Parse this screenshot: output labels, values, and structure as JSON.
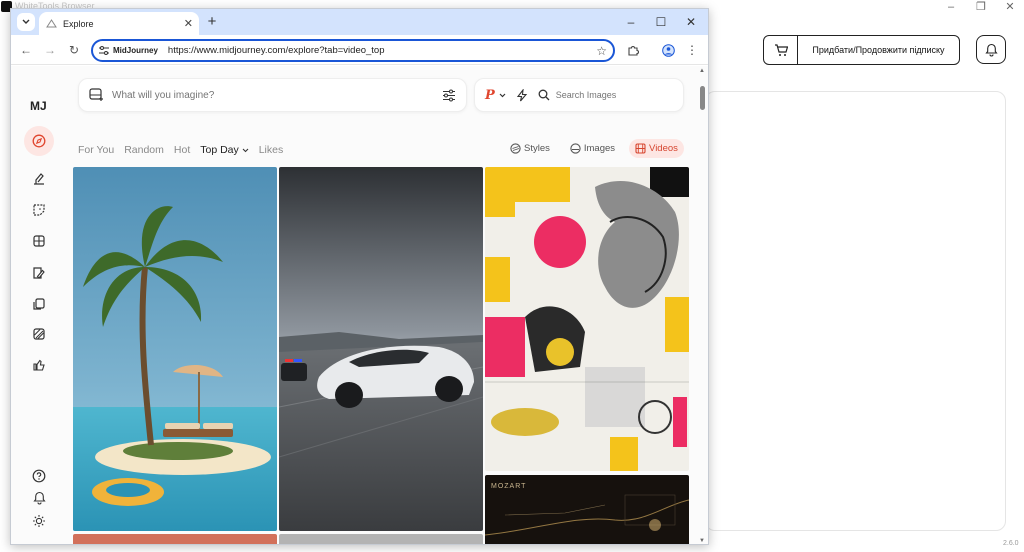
{
  "host": {
    "title": "WhiteTools Browser",
    "cart_label": "Придбати/Продовжити підписку",
    "version": "2.6.0"
  },
  "browser": {
    "tab_title": "Explore",
    "site_chip": "MidJourney",
    "url": "https://www.midjourney.com/explore?tab=video_top"
  },
  "sidebar": {
    "logo": "MJ",
    "items": [
      {
        "icon": "compass-icon",
        "active": true
      },
      {
        "icon": "brush-icon"
      },
      {
        "icon": "sticker-icon"
      },
      {
        "icon": "grid-icon"
      },
      {
        "icon": "edit-image-icon"
      },
      {
        "icon": "copy-icon"
      },
      {
        "icon": "pattern-icon"
      },
      {
        "icon": "thumbs-up-icon"
      }
    ],
    "bottom": [
      {
        "icon": "help-icon"
      },
      {
        "icon": "bell-icon"
      },
      {
        "icon": "sun-icon"
      }
    ]
  },
  "prompt": {
    "placeholder": "What will you imagine?"
  },
  "search": {
    "placeholder": "Search Images",
    "p_label": "P"
  },
  "filters": {
    "tabs": [
      "For You",
      "Random",
      "Hot",
      "Top Day",
      "Likes"
    ],
    "active": "Top Day",
    "types": [
      "Styles",
      "Images",
      "Videos"
    ],
    "active_type": "Videos"
  },
  "gallery": {
    "cards": [
      {
        "name": "palm-island-card",
        "subject": "palm-island"
      },
      {
        "name": "sports-car-card",
        "subject": "sports-car"
      },
      {
        "name": "collage-card",
        "subject": "collage"
      },
      {
        "name": "mozart-card",
        "subject": "mozart",
        "caption": "MOZART"
      }
    ]
  },
  "colors": {
    "accent": "#e0462f",
    "accent_bg": "#fde6e3",
    "tabbar": "#d3e3fd",
    "omnibox_border": "#1a56d6"
  }
}
